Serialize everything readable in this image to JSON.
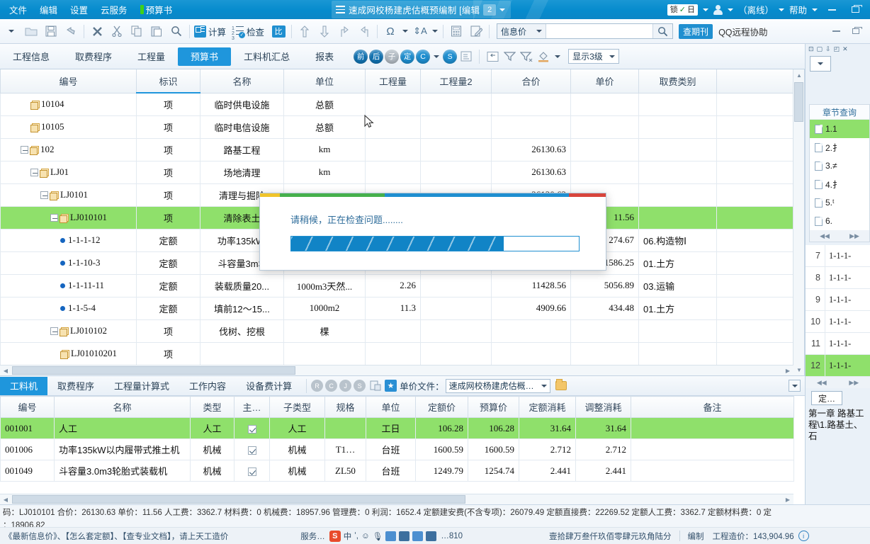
{
  "titlebar": {
    "menus": [
      "文件",
      "编辑",
      "设置",
      "云服务"
    ],
    "project_menu": "预算书",
    "doc_title": "速成网校杨建虎估概预编制  [编辑",
    "doc_badge": "2",
    "lock_label": "锁",
    "lock_suffix": "日",
    "offline": "（离线）",
    "help": "帮助"
  },
  "toolbar": {
    "calc_label": "计算",
    "check_label": "检查",
    "bi_label": "比",
    "search_category": "信息价",
    "search_value": "",
    "search_placeholder": "",
    "journal_badge": "查期刊",
    "qq_label": "QQ远程协助"
  },
  "tabs": {
    "items": [
      "工程信息",
      "取费程序",
      "工程量",
      "预算书",
      "工料机汇总",
      "报表"
    ],
    "active": "预算书",
    "round_icons": [
      "前",
      "后",
      "子",
      "定",
      "C",
      "S"
    ],
    "level_select": "显示3级"
  },
  "grid": {
    "headers": [
      "编号",
      "标识",
      "名称",
      "单位",
      "工程量",
      "工程量2",
      "合价",
      "单价",
      "取费类别",
      ""
    ],
    "selected_header": "标识",
    "rows": [
      {
        "indent": 2,
        "icon": "folder",
        "code": "10104",
        "expand": false,
        "mark": "项",
        "name": "临时供电设施",
        "unit": "总额",
        "qty": "",
        "qty2": "",
        "total": "",
        "price": "",
        "fee": ""
      },
      {
        "indent": 2,
        "icon": "folder",
        "code": "10105",
        "expand": false,
        "mark": "项",
        "name": "临时电信设施",
        "unit": "总额",
        "qty": "",
        "qty2": "",
        "total": "",
        "price": "",
        "fee": ""
      },
      {
        "indent": 1,
        "icon": "folder",
        "code": "102",
        "expand": true,
        "mark": "项",
        "name": "路基工程",
        "unit": "km",
        "qty": "",
        "qty2": "",
        "total": "26130.63",
        "price": "",
        "fee": ""
      },
      {
        "indent": 2,
        "icon": "folder",
        "code": "LJ01",
        "expand": true,
        "mark": "项",
        "name": "场地清理",
        "unit": "km",
        "qty": "",
        "qty2": "",
        "total": "26130.63",
        "price": "",
        "fee": ""
      },
      {
        "indent": 3,
        "icon": "folder",
        "code": "LJ0101",
        "expand": true,
        "mark": "项",
        "name": "清理与掘除",
        "unit": "",
        "qty": "",
        "qty2": "",
        "total": "26130.63",
        "price": "",
        "fee": ""
      },
      {
        "indent": 4,
        "icon": "folder",
        "code": "LJ010101",
        "expand": true,
        "mark": "项",
        "name": "清除表土",
        "unit": "",
        "qty": "",
        "qty2": "",
        "total": "",
        "price": "11.56",
        "fee": "",
        "selected": true
      },
      {
        "indent": 5,
        "icon": "dot",
        "code": "1-1-1-12",
        "expand": false,
        "mark": "定额",
        "name": "功率135kW.",
        "unit": "",
        "qty": "",
        "qty2": "",
        "total": "",
        "price": "274.67",
        "fee": "06.构造物Ⅰ"
      },
      {
        "indent": 5,
        "icon": "dot",
        "code": "1-1-10-3",
        "expand": false,
        "mark": "定额",
        "name": "斗容量3m3.",
        "unit": "",
        "qty": "",
        "qty2": "",
        "total": "",
        "price": "1586.25",
        "fee": "01.土方"
      },
      {
        "indent": 5,
        "icon": "dot",
        "code": "1-1-11-11",
        "expand": false,
        "mark": "定额",
        "name": "装载质量20...",
        "unit": "1000m3天然...",
        "qty": "2.26",
        "qty2": "",
        "total": "11428.56",
        "price": "5056.89",
        "fee": "03.运输"
      },
      {
        "indent": 5,
        "icon": "dot",
        "code": "1-1-5-4",
        "expand": false,
        "mark": "定额",
        "name": "填前12～15...",
        "unit": "1000m2",
        "qty": "11.3",
        "qty2": "",
        "total": "4909.66",
        "price": "434.48",
        "fee": "01.土方"
      },
      {
        "indent": 4,
        "icon": "folder",
        "code": "LJ010102",
        "expand": true,
        "mark": "项",
        "name": "伐树、挖根",
        "unit": "棵",
        "qty": "",
        "qty2": "",
        "total": "",
        "price": "",
        "fee": ""
      },
      {
        "indent": 5,
        "icon": "folder",
        "code": "LJ01010201",
        "expand": false,
        "mark": "项",
        "name": "",
        "unit": "",
        "qty": "",
        "qty2": "",
        "total": "",
        "price": "",
        "fee": ""
      }
    ]
  },
  "dialog": {
    "message": "请稍候，正在检查问题........",
    "progress_percent": 74
  },
  "right_panel": {
    "section_title": "章节查询",
    "section_items": [
      "1.1",
      "2.扌",
      "3.≠",
      "4.扌",
      "5.ᵗ",
      "6."
    ],
    "active_section": "1.1",
    "rows": [
      {
        "num": "7",
        "code": "1-1-1-"
      },
      {
        "num": "8",
        "code": "1-1-1-"
      },
      {
        "num": "9",
        "code": "1-1-1-"
      },
      {
        "num": "10",
        "code": "1-1-1-"
      },
      {
        "num": "11",
        "code": "1-1-1-"
      },
      {
        "num": "12",
        "code": "1-1-1-",
        "selected": true
      }
    ],
    "def_button": "定…",
    "note": "第一章 路基工程\\1.路基土、石"
  },
  "bottom": {
    "tabs": [
      "工料机",
      "取费程序",
      "工程量计算式",
      "工作内容",
      "设备费计算"
    ],
    "active_tab": "工料机",
    "round_icons": [
      "R",
      "C",
      "J",
      "S"
    ],
    "price_file_label": "单价文件：",
    "price_file_value": "速成网校杨建虎估概…",
    "headers": [
      "编号",
      "名称",
      "类型",
      "主…",
      "子类型",
      "规格",
      "单位",
      "定额价",
      "预算价",
      "定额消耗",
      "调整消耗",
      "备注"
    ],
    "rows": [
      {
        "code": "001001",
        "name": "人工",
        "type": "人工",
        "main": true,
        "subtype": "人工",
        "spec": "",
        "unit": "工日",
        "def_price": "106.28",
        "bud_price": "106.28",
        "def_use": "31.64",
        "adj_use": "31.64",
        "note": "",
        "selected": true,
        "bud_red": false
      },
      {
        "code": "001006",
        "name": "功率135kW以内履带式推土机",
        "type": "机械",
        "main": true,
        "subtype": "机械",
        "spec": "T1…",
        "unit": "台班",
        "def_price": "1600.59",
        "bud_price": "1600.59",
        "def_use": "2.712",
        "adj_use": "2.712",
        "note": "",
        "selected": false,
        "bud_red": false
      },
      {
        "code": "001049",
        "name": "斗容量3.0m3轮胎式装载机",
        "type": "机械",
        "main": true,
        "subtype": "机械",
        "spec": "ZL50",
        "unit": "台班",
        "def_price": "1249.79",
        "bud_price": "1254.74",
        "def_use": "2.441",
        "adj_use": "2.441",
        "note": "",
        "selected": false,
        "bud_red": true
      }
    ]
  },
  "status": {
    "line1": "码：LJ010101  合价：26130.63  单价：11.56   人工费：3362.7  材料费：0  机械费：18957.96  管理费：0  利润：1652.4  定额建安费(不含专项)：26079.49  定额直接费：22269.52  定额人工费：3362.7  定额材料费：0  定",
    "line2": "：18906.82",
    "left": "《最新信息价》、【怎么套定额】、【查专业文档】，请上天工造价",
    "service": "服务…",
    "phone": "…810",
    "amount_cn": "壹拾肆万叁仟玖佰零肆元玖角陆分",
    "mode": "编制",
    "total_label": "工程造价：143,904.96",
    "ime_label": "中"
  }
}
